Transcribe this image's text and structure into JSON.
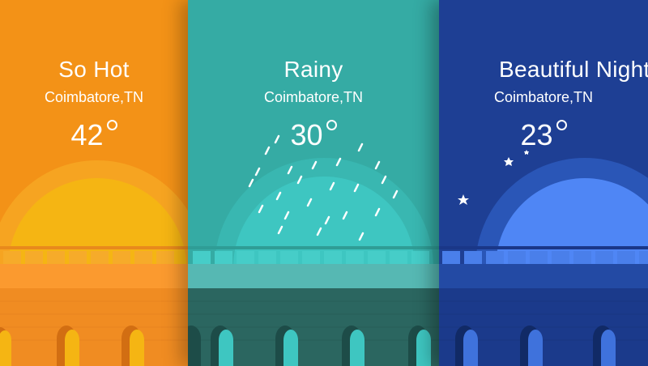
{
  "cards": [
    {
      "condition": "So Hot",
      "location": "Coimbatore,TN",
      "temperature": "42",
      "colors": {
        "sky": "#f39217",
        "sun": "#f6be12",
        "ground": "#f08c22"
      }
    },
    {
      "condition": "Rainy",
      "location": "Coimbatore,TN",
      "temperature": "30",
      "colors": {
        "sky": "#35aba4",
        "dome": "#3ec6c1",
        "ground": "#2b6660"
      }
    },
    {
      "condition": "Beautiful Night",
      "location": "Coimbatore,TN",
      "temperature": "23",
      "colors": {
        "sky": "#1e3f94",
        "moon": "#4f86f5",
        "ground": "#1b3a8b"
      }
    }
  ]
}
